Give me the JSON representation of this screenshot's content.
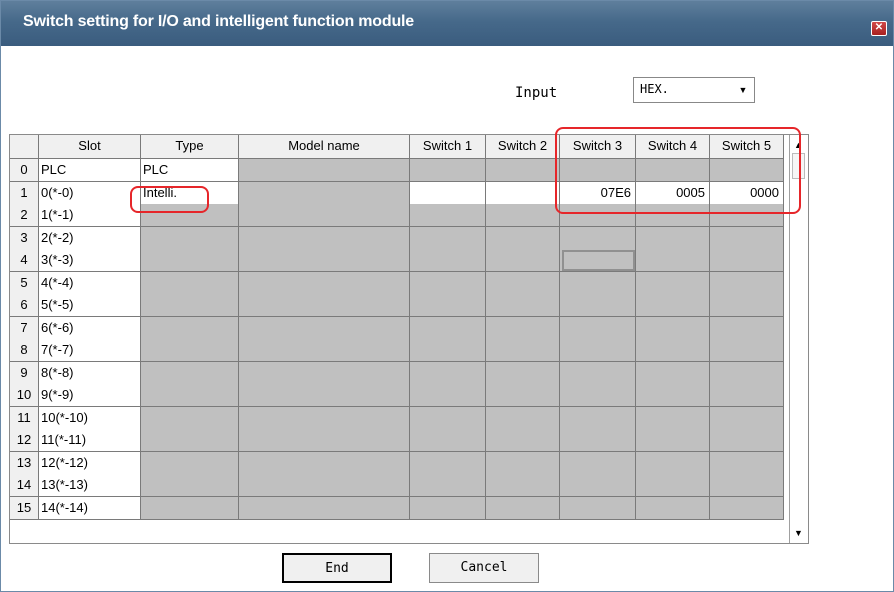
{
  "window": {
    "title": "Switch setting for I/O and intelligent function module"
  },
  "input": {
    "label": "Input",
    "selected": "HEX."
  },
  "grid": {
    "headers": [
      "",
      "Slot",
      "Type",
      "Model name",
      "Switch 1",
      "Switch 2",
      "Switch 3",
      "Switch 4",
      "Switch 5"
    ],
    "rows": [
      {
        "num": "0",
        "slot": "PLC",
        "type": "PLC",
        "model": "",
        "s1": "",
        "s2": "",
        "s3": "",
        "s4": "",
        "s5": ""
      },
      {
        "num": "1",
        "slot": "0(*-0)",
        "type": "Intelli.",
        "model": "",
        "s1": "",
        "s2": "",
        "s3": "07E6",
        "s4": "0005",
        "s5": "0000"
      },
      {
        "num": "2",
        "slot": "1(*-1)",
        "type": "",
        "model": "",
        "s1": "",
        "s2": "",
        "s3": "",
        "s4": "",
        "s5": ""
      },
      {
        "num": "3",
        "slot": "2(*-2)",
        "type": "",
        "model": "",
        "s1": "",
        "s2": "",
        "s3": "",
        "s4": "",
        "s5": ""
      },
      {
        "num": "4",
        "slot": "3(*-3)",
        "type": "",
        "model": "",
        "s1": "",
        "s2": "",
        "s3": "",
        "s4": "",
        "s5": ""
      },
      {
        "num": "5",
        "slot": "4(*-4)",
        "type": "",
        "model": "",
        "s1": "",
        "s2": "",
        "s3": "",
        "s4": "",
        "s5": ""
      },
      {
        "num": "6",
        "slot": "5(*-5)",
        "type": "",
        "model": "",
        "s1": "",
        "s2": "",
        "s3": "",
        "s4": "",
        "s5": ""
      },
      {
        "num": "7",
        "slot": "6(*-6)",
        "type": "",
        "model": "",
        "s1": "",
        "s2": "",
        "s3": "",
        "s4": "",
        "s5": ""
      },
      {
        "num": "8",
        "slot": "7(*-7)",
        "type": "",
        "model": "",
        "s1": "",
        "s2": "",
        "s3": "",
        "s4": "",
        "s5": ""
      },
      {
        "num": "9",
        "slot": "8(*-8)",
        "type": "",
        "model": "",
        "s1": "",
        "s2": "",
        "s3": "",
        "s4": "",
        "s5": ""
      },
      {
        "num": "10",
        "slot": "9(*-9)",
        "type": "",
        "model": "",
        "s1": "",
        "s2": "",
        "s3": "",
        "s4": "",
        "s5": ""
      },
      {
        "num": "11",
        "slot": "10(*-10)",
        "type": "",
        "model": "",
        "s1": "",
        "s2": "",
        "s3": "",
        "s4": "",
        "s5": ""
      },
      {
        "num": "12",
        "slot": "11(*-11)",
        "type": "",
        "model": "",
        "s1": "",
        "s2": "",
        "s3": "",
        "s4": "",
        "s5": ""
      },
      {
        "num": "13",
        "slot": "12(*-12)",
        "type": "",
        "model": "",
        "s1": "",
        "s2": "",
        "s3": "",
        "s4": "",
        "s5": ""
      },
      {
        "num": "14",
        "slot": "13(*-13)",
        "type": "",
        "model": "",
        "s1": "",
        "s2": "",
        "s3": "",
        "s4": "",
        "s5": ""
      },
      {
        "num": "15",
        "slot": "14(*-14)",
        "type": "",
        "model": "",
        "s1": "",
        "s2": "",
        "s3": "",
        "s4": "",
        "s5": ""
      }
    ]
  },
  "buttons": {
    "end": "End",
    "cancel": "Cancel"
  },
  "colors": {
    "titlebar": "#46698a",
    "cell_disabled": "#c0c0c0",
    "highlight": "#e6262a"
  },
  "icons": {
    "close": "close-icon",
    "dropdown": "chevron-down-icon",
    "scroll_up": "arrow-up-icon",
    "scroll_down": "arrow-down-icon"
  }
}
